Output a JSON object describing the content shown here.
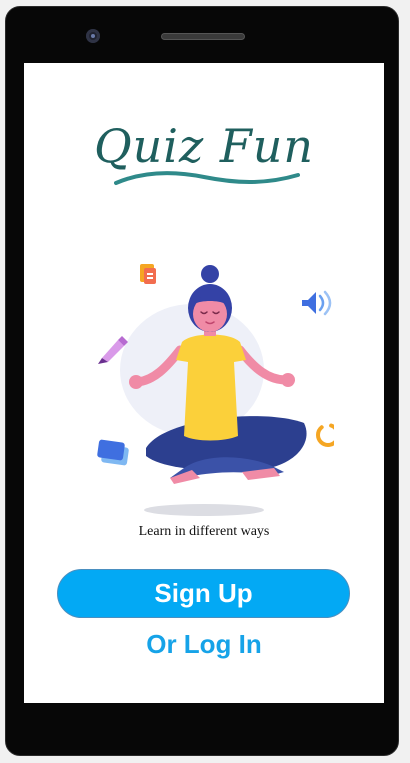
{
  "app": {
    "title": "Quiz Fun",
    "tagline": "Learn in different ways"
  },
  "actions": {
    "signup_label": "Sign Up",
    "login_label": "Or Log In"
  },
  "colors": {
    "title": "#1f5f5e",
    "underline": "#2f8a8a",
    "signup_bg": "#03a9f4",
    "login_text": "#16a3e8"
  },
  "illustration": {
    "subject": "meditating-woman",
    "icons": [
      "document-icon",
      "speaker-icon",
      "pencil-icon",
      "cards-icon",
      "loading-ring-icon"
    ]
  }
}
